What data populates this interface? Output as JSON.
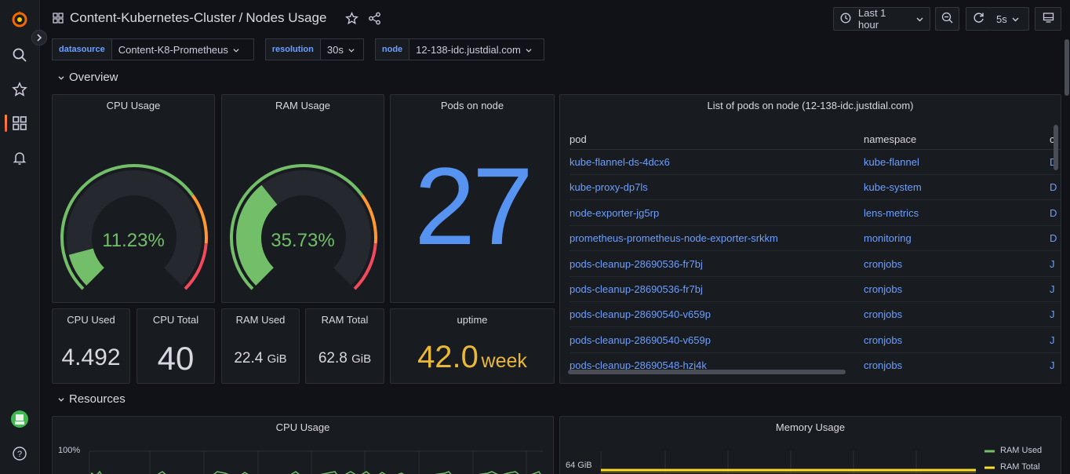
{
  "header": {
    "folder": "Content-Kubernetes-Cluster",
    "separator": "/",
    "dashboard": "Nodes Usage",
    "time_range": "Last 1 hour",
    "refresh": "5s"
  },
  "variables": [
    {
      "label": "datasource",
      "value": "Content-K8-Prometheus"
    },
    {
      "label": "resolution",
      "value": "30s"
    },
    {
      "label": "node",
      "value": "12-138-idc.justdial.com"
    }
  ],
  "rows": {
    "overview": "Overview",
    "resources": "Resources"
  },
  "panels": {
    "cpu_usage": {
      "title": "CPU Usage",
      "value": "11.23%",
      "fraction": 0.1123
    },
    "ram_usage": {
      "title": "RAM Usage",
      "value": "35.73%",
      "fraction": 0.3573
    },
    "pods": {
      "title": "Pods on node",
      "value": "27"
    },
    "cpu_used": {
      "title": "CPU Used",
      "value": "4.492"
    },
    "cpu_total": {
      "title": "CPU Total",
      "value": "40"
    },
    "ram_used": {
      "title": "RAM Used",
      "value": "22.4",
      "unit": "GiB"
    },
    "ram_total": {
      "title": "RAM Total",
      "value": "62.8",
      "unit": "GiB"
    },
    "uptime": {
      "title": "uptime",
      "value": "42.0",
      "unit": "week"
    }
  },
  "pods_table": {
    "title": "List of pods on node (12-138-idc.justdial.com)",
    "columns": [
      "pod",
      "namespace",
      "c"
    ],
    "rows": [
      {
        "pod": "kube-flannel-ds-4dcx6",
        "namespace": "kube-flannel",
        "c": "D"
      },
      {
        "pod": "kube-proxy-dp7ls",
        "namespace": "kube-system",
        "c": "D"
      },
      {
        "pod": "node-exporter-jg5rp",
        "namespace": "lens-metrics",
        "c": "D"
      },
      {
        "pod": "prometheus-prometheus-node-exporter-srkkm",
        "namespace": "monitoring",
        "c": "D"
      },
      {
        "pod": "pods-cleanup-28690536-fr7bj",
        "namespace": "cronjobs",
        "c": "J"
      },
      {
        "pod": "pods-cleanup-28690536-fr7bj",
        "namespace": "cronjobs",
        "c": "J"
      },
      {
        "pod": "pods-cleanup-28690540-v659p",
        "namespace": "cronjobs",
        "c": "J"
      },
      {
        "pod": "pods-cleanup-28690540-v659p",
        "namespace": "cronjobs",
        "c": "J"
      },
      {
        "pod": "pods-cleanup-28690548-hzj4k",
        "namespace": "cronjobs",
        "c": "J"
      }
    ]
  },
  "resource_panels": {
    "cpu": {
      "title": "CPU Usage",
      "axis_label": "100%"
    },
    "memory": {
      "title": "Memory Usage",
      "axis_label": "64 GiB",
      "legend": [
        "RAM Used",
        "RAM Total"
      ]
    }
  },
  "colors": {
    "green": "#73bf69",
    "orange": "#ff9830",
    "red": "#f2495c",
    "blue": "#5794f2",
    "yellow": "#fade2a",
    "uptime": "#eab839"
  }
}
